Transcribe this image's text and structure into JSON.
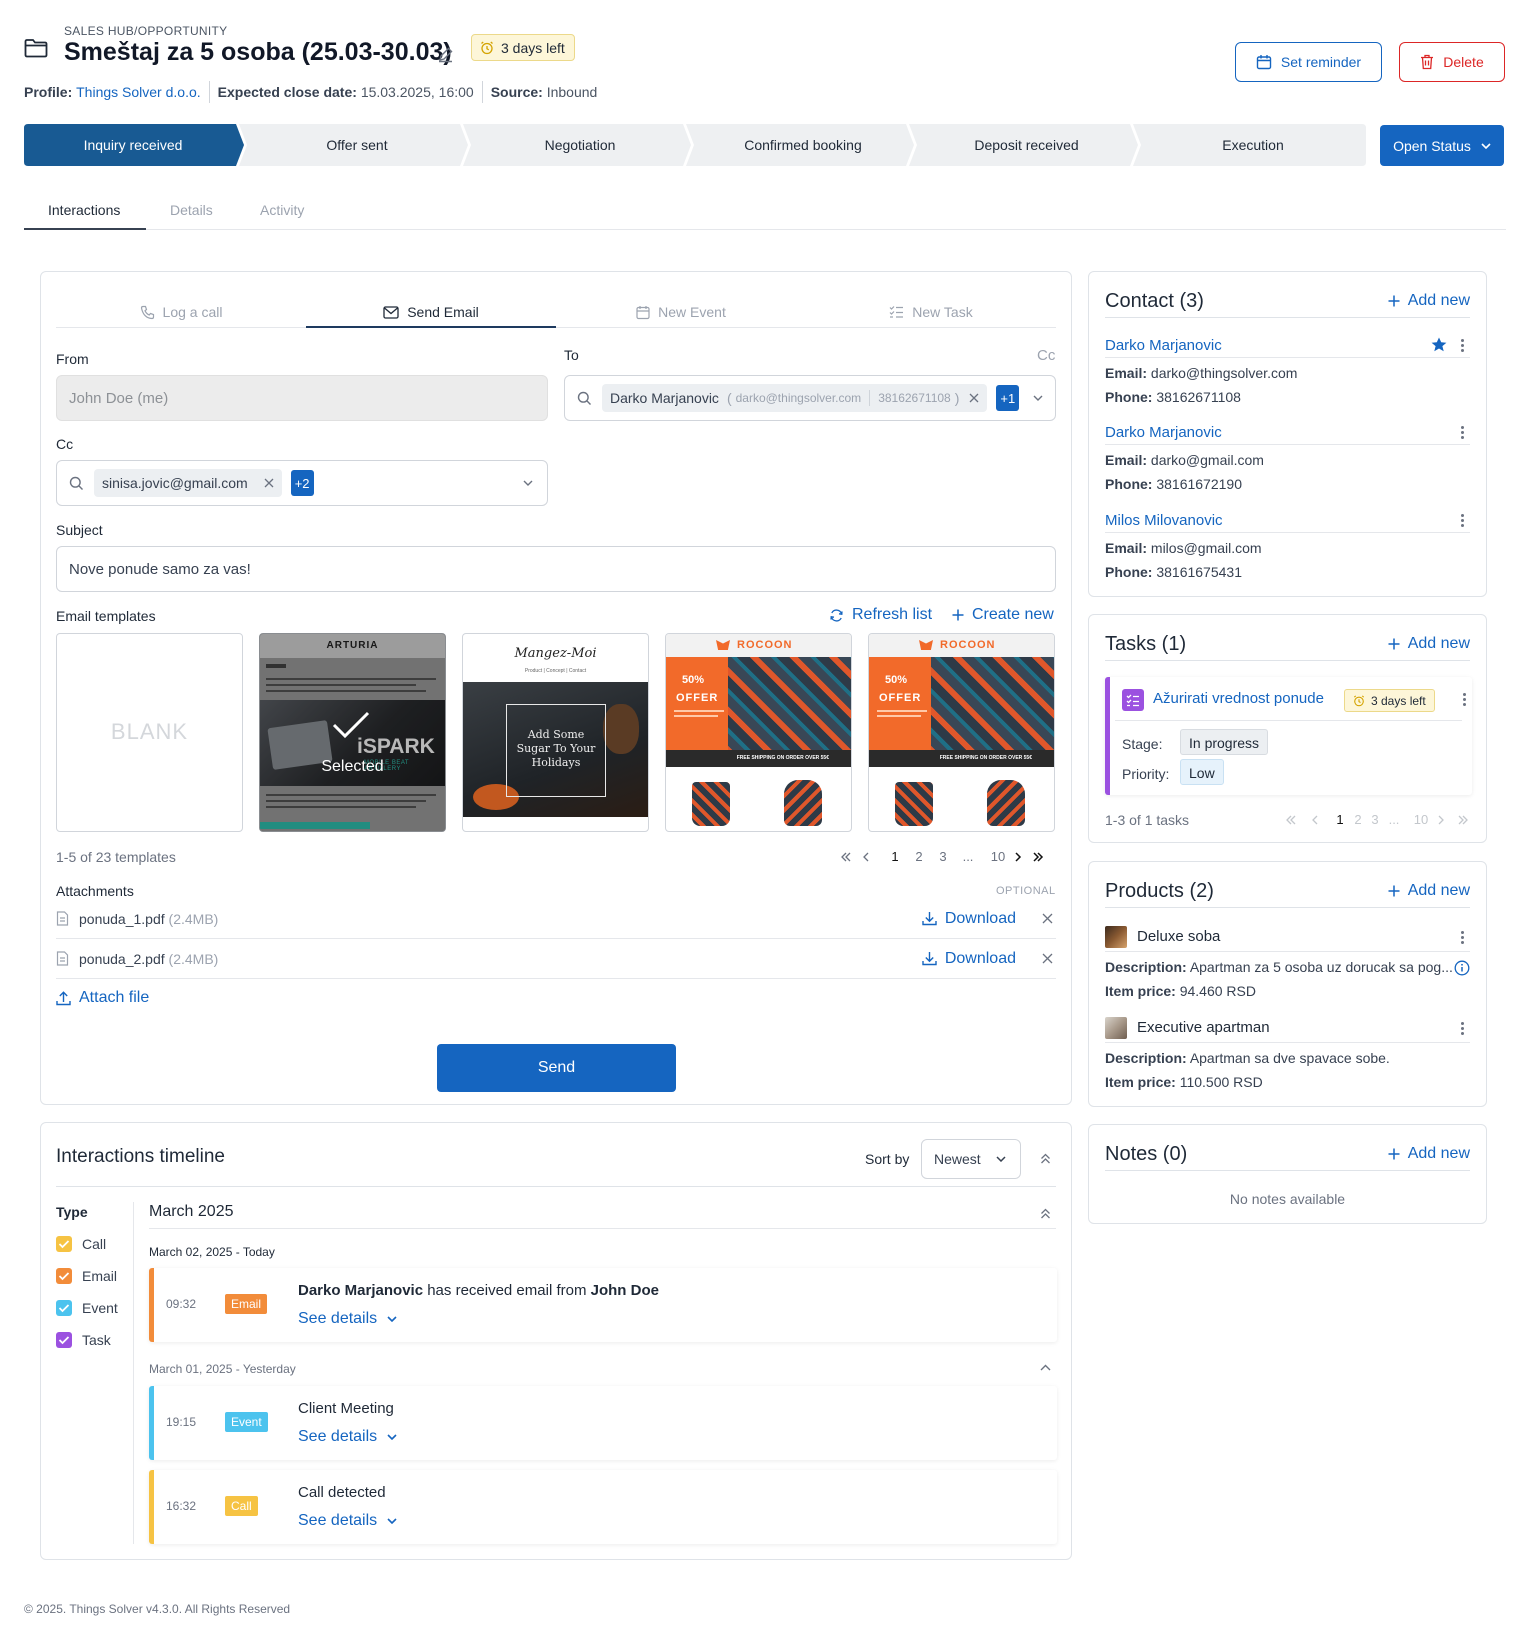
{
  "header": {
    "breadcrumb": "SALES HUB/OPPORTUNITY",
    "title": "Smeštaj za 5 osoba (25.03-30.03)",
    "days_left": "3 days left",
    "profile_label": "Profile:",
    "profile_value": "Things Solver d.o.o.",
    "close_label": "Expected close date:",
    "close_value": "15.03.2025, 16:00",
    "source_label": "Source:",
    "source_value": "Inbound",
    "reminder_label": "Set reminder",
    "delete_label": "Delete"
  },
  "pipeline": {
    "stages": [
      "Inquiry received",
      "Offer sent",
      "Negotiation",
      "Confirmed booking",
      "Deposit received",
      "Execution"
    ],
    "active_index": 0,
    "status_button": "Open Status"
  },
  "tabs": [
    "Interactions",
    "Details",
    "Activity"
  ],
  "composer": {
    "subtabs": [
      "Log a call",
      "Send Email",
      "New Event",
      "New Task"
    ],
    "from_label": "From",
    "from_value": "John Doe (me)",
    "to_label": "To",
    "cc_toggle": "Cc",
    "to_chip_name": "Darko Marjanovic",
    "to_chip_open": "(",
    "to_chip_email": "darko@thingsolver.com",
    "to_chip_phone": "38162671108",
    "to_chip_close": ")",
    "to_more": "+1",
    "cc_label": "Cc",
    "cc_chip": "sinisa.jovic@gmail.com",
    "cc_more": "+2",
    "subject_label": "Subject",
    "subject_value": "Nove ponude samo za vas!",
    "templates_label": "Email templates",
    "refresh_label": "Refresh list",
    "create_label": "Create new",
    "templates": {
      "blank": "BLANK",
      "selected_label": "Selected",
      "arturia_brand": "ARTURIA",
      "arturia_product": "iSPARK",
      "arturia_sub": "MOBILE BEAT ARTILLERY",
      "mangez_brand": "Mangez-Moi",
      "mangez_nav": "Product | Concept | Contact",
      "mangez_headline": "Add Some Sugar To Your Holidays",
      "rocoon_brand": "ROCOON",
      "rocoon_offer_pct": "50%",
      "rocoon_offer_word": "OFFER",
      "rocoon_shipping": "FREE SHIPPING ON ORDER OVER 55€"
    },
    "templates_count": "1-5 of 23 templates",
    "templates_pages": [
      "1",
      "2",
      "3",
      "...",
      "10"
    ],
    "attachments_label": "Attachments",
    "attachments_optional": "OPTIONAL",
    "attachments": [
      {
        "name": "ponuda_1.pdf",
        "size": "(2.4MB)"
      },
      {
        "name": "ponuda_2.pdf",
        "size": "(2.4MB)"
      }
    ],
    "download_label": "Download",
    "attach_label": "Attach file",
    "send_label": "Send"
  },
  "timeline": {
    "title": "Interactions timeline",
    "sort_label": "Sort by",
    "sort_value": "Newest",
    "type_label": "Type",
    "types": [
      "Call",
      "Email",
      "Event",
      "Task"
    ],
    "type_colors": [
      "#f6c343",
      "#f28c3a",
      "#4cc3ee",
      "#9b51e0"
    ],
    "month": "March 2025",
    "day1": "March 02, 2025 - Today",
    "day2": "March 01, 2025 - Yesterday",
    "see_details": "See details",
    "items": [
      {
        "time": "09:32",
        "type": "Email",
        "color": "#f28c3a",
        "who": "Darko Marjanovic",
        "mid": "has received email from",
        "from": "John Doe"
      },
      {
        "time": "19:15",
        "type": "Event",
        "color": "#4cc3ee",
        "text": "Client Meeting"
      },
      {
        "time": "16:32",
        "type": "Call",
        "color": "#f6c343",
        "text": "Call detected"
      }
    ]
  },
  "contacts": {
    "title": "Contact (3)",
    "add": "Add new",
    "email_label": "Email:",
    "phone_label": "Phone:",
    "list": [
      {
        "name": "Darko Marjanovic",
        "email": "darko@thingsolver.com",
        "phone": "38162671108",
        "starred": true
      },
      {
        "name": "Darko Marjanovic",
        "email": "darko@gmail.com",
        "phone": "38161672190"
      },
      {
        "name": "Milos Milovanovic",
        "email": "milos@gmail.com",
        "phone": "38161675431"
      }
    ]
  },
  "tasks": {
    "title": "Tasks (1)",
    "add": "Add new",
    "task_name": "Ažurirati vrednost ponude",
    "task_days": "3 days left",
    "stage_label": "Stage:",
    "stage_value": "In progress",
    "priority_label": "Priority:",
    "priority_value": "Low",
    "count": "1-3 of 1 tasks",
    "pages": [
      "1",
      "2",
      "3",
      "...",
      "10"
    ]
  },
  "products": {
    "title": "Products (2)",
    "add": "Add new",
    "desc_label": "Description:",
    "price_label": "Item price:",
    "list": [
      {
        "name": "Deluxe soba",
        "desc": "Apartman za 5 osoba uz dorucak sa pog...",
        "price": "94.460 RSD"
      },
      {
        "name": "Executive apartman",
        "desc": "Apartman sa dve spavace sobe.",
        "price": "110.500 RSD"
      }
    ]
  },
  "notes": {
    "title": "Notes (0)",
    "add": "Add new",
    "empty": "No notes available"
  },
  "footer": "© 2025. Things Solver v4.3.0. All Rights Reserved"
}
